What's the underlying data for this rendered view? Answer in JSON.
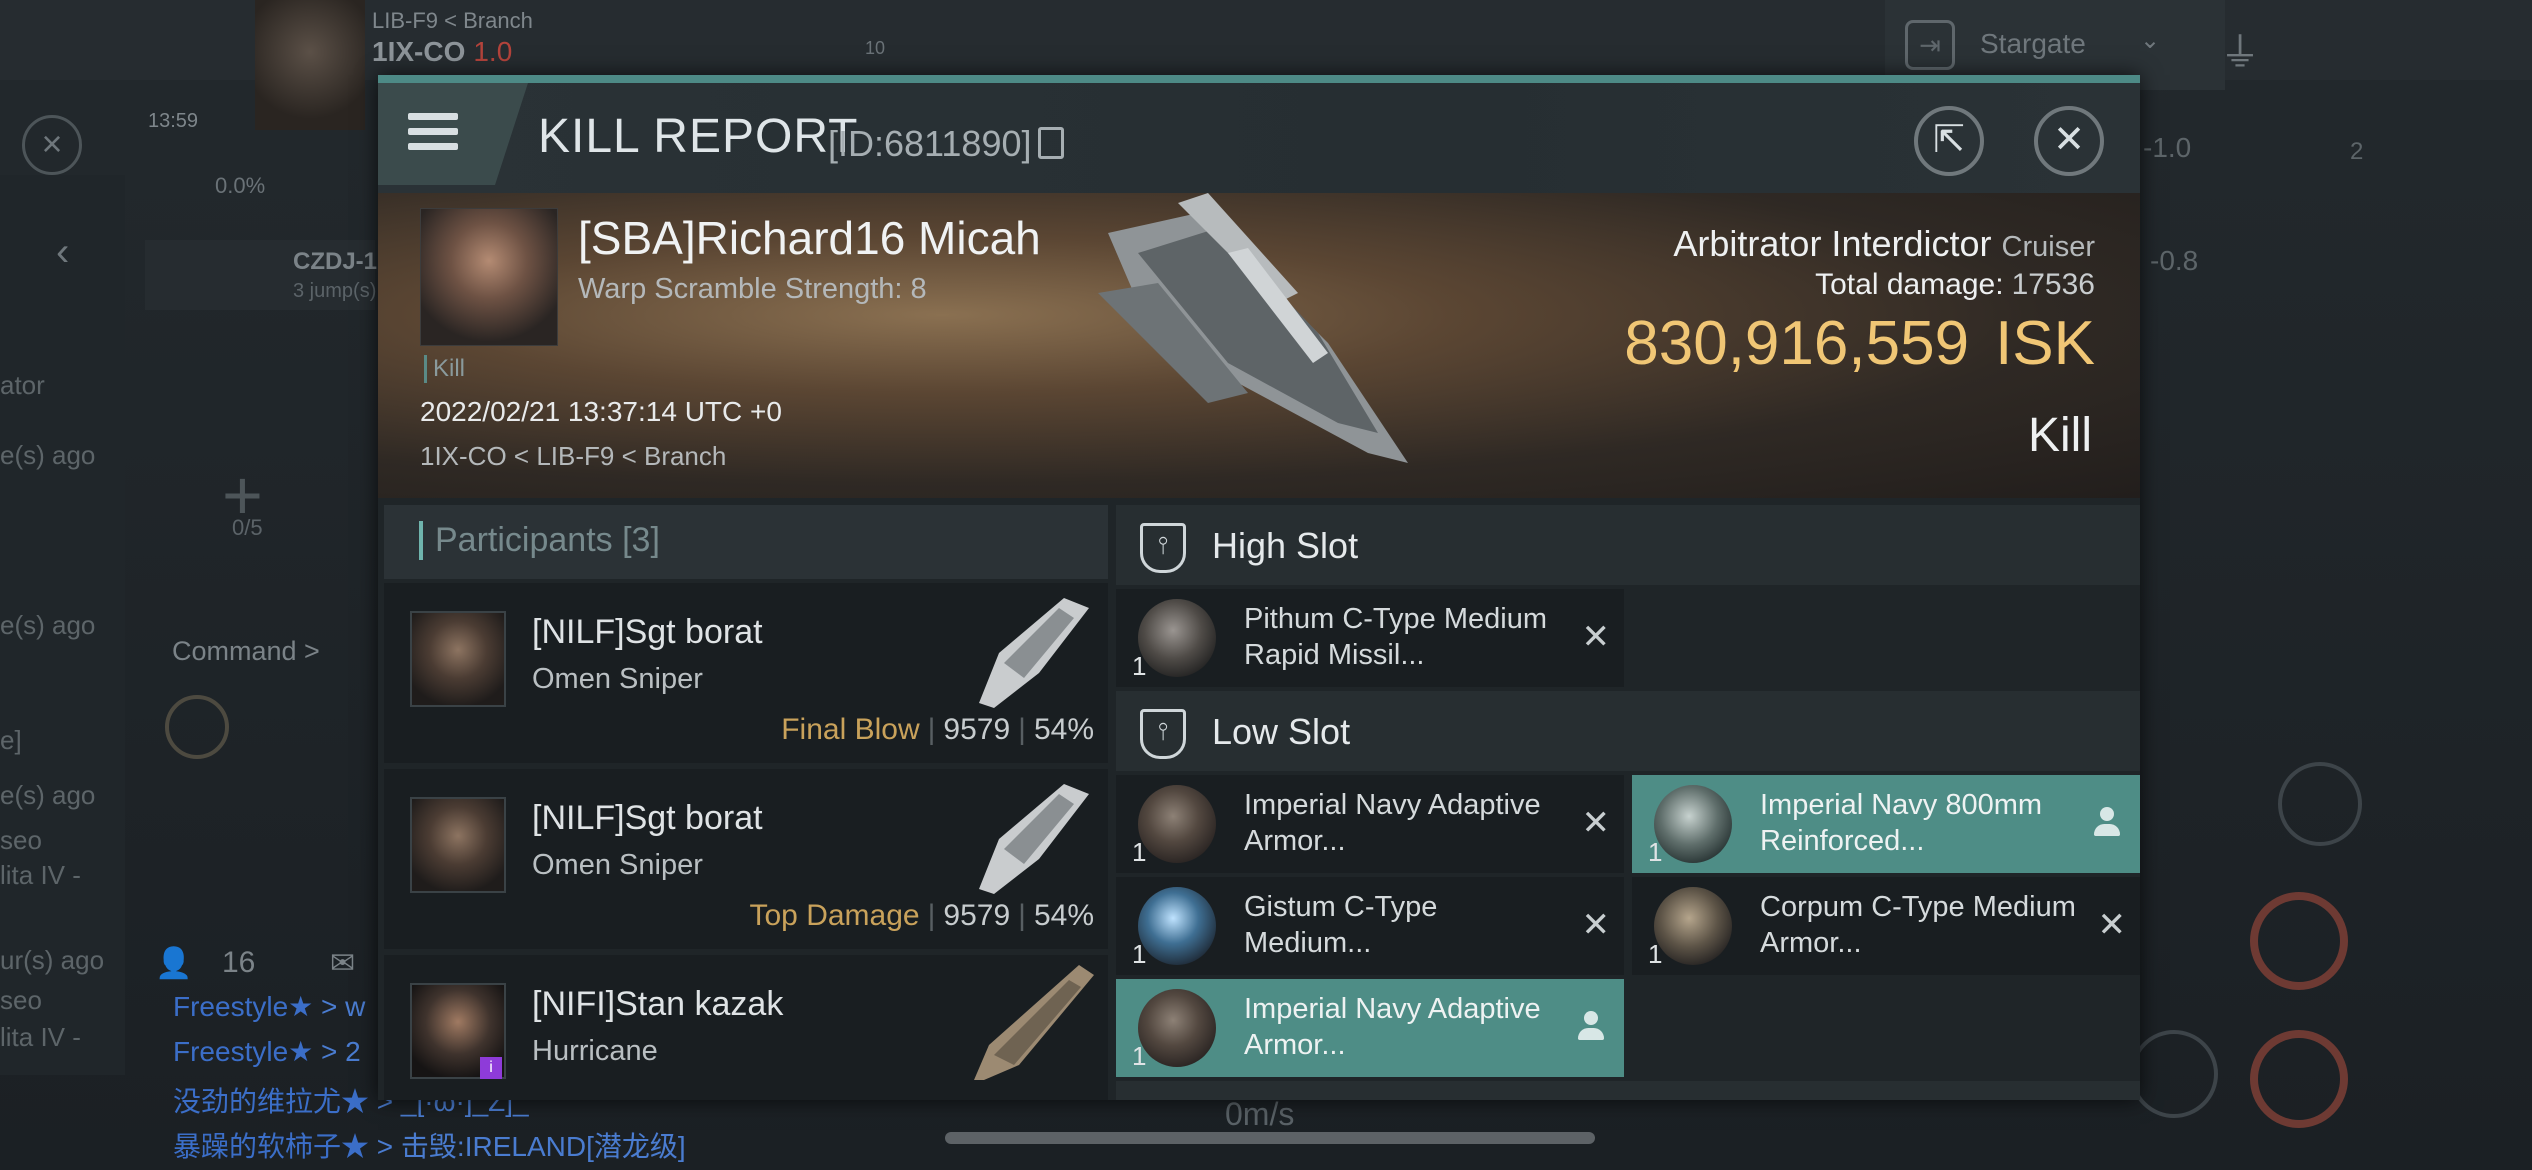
{
  "background": {
    "route": "LIB-F9 < Branch",
    "system": "1IX-CO",
    "security": "1.0",
    "count_badge": "10",
    "clock": "13:59",
    "percent": "0.0%",
    "stargate_label": "Stargate",
    "nearby_name": "CZDJ-1",
    "nearby_jumps": "3 jump(s)",
    "command_label": "Command >",
    "fleet_slots": "0/5",
    "online_count": "16",
    "right_value_1": "-1.0",
    "right_value_2": "-0.8",
    "right_badge": "2",
    "speed": "0m/s",
    "left_texts": [
      "ator",
      "e(s) ago",
      "e(s) ago",
      "e]",
      "e(s) ago",
      "seo",
      "lita IV -",
      "ur(s) ago",
      "seo",
      "lita IV -"
    ],
    "chat": [
      {
        "name": "Freestyle★",
        "msg": " > w"
      },
      {
        "name": "Freestyle★",
        "msg": " > 2"
      },
      {
        "name": "没劲的维拉尤★",
        "msg": " > _[·ω·]_Z]_"
      },
      {
        "name": "暴躁的软柿子★",
        "msg": " > 击毁:IRELAND[潜龙级]"
      }
    ]
  },
  "window": {
    "title": "KILL REPORT",
    "report_id": "[ID:6811890]",
    "colors": {
      "accent": "#4d8a86",
      "isk": "#f0c675",
      "final_blow": "#c9a25b",
      "highlight": "#4e8d86"
    }
  },
  "victim": {
    "name": "[SBA]Richard16 Micah",
    "warp_scramble": "Warp Scramble Strength: 8",
    "tag": "Kill",
    "date": "2022/02/21 13:37:14 UTC +0",
    "location": "1IX-CO < LIB-F9 < Branch",
    "ship_name": "Arbitrator Interdictor",
    "ship_category": "Cruiser",
    "total_damage_label": "Total damage:",
    "total_damage": "17536",
    "isk_value": "830,916,559",
    "isk_unit": "ISK",
    "result": "Kill"
  },
  "participants": {
    "header": "Participants [3]",
    "rows": [
      {
        "name": "[NILF]Sgt borat",
        "ship": "Omen Sniper",
        "tag": "Final Blow",
        "damage": "9579",
        "percent": "54%"
      },
      {
        "name": "[NILF]Sgt borat",
        "ship": "Omen Sniper",
        "tag": "Top Damage",
        "damage": "9579",
        "percent": "54%"
      },
      {
        "name": "[NIFI]Stan kazak",
        "ship": "Hurricane",
        "tag": "",
        "damage": "",
        "percent": ""
      }
    ]
  },
  "fitting": {
    "high_slot": {
      "title": "High Slot",
      "items": [
        {
          "name": "Pithum C-Type Medium Rapid Missil...",
          "qty": "1",
          "status": "destroyed"
        }
      ]
    },
    "low_slot": {
      "title": "Low Slot",
      "items": [
        {
          "name": "Imperial Navy Adaptive Armor...",
          "qty": "1",
          "status": "destroyed"
        },
        {
          "name": "Imperial Navy 800mm Reinforced...",
          "qty": "1",
          "status": "dropped"
        },
        {
          "name": "Gistum C-Type Medium...",
          "qty": "1",
          "status": "destroyed"
        },
        {
          "name": "Corpum C-Type Medium Armor...",
          "qty": "1",
          "status": "destroyed"
        },
        {
          "name": "Imperial Navy Adaptive Armor...",
          "qty": "1",
          "status": "dropped"
        }
      ]
    }
  }
}
